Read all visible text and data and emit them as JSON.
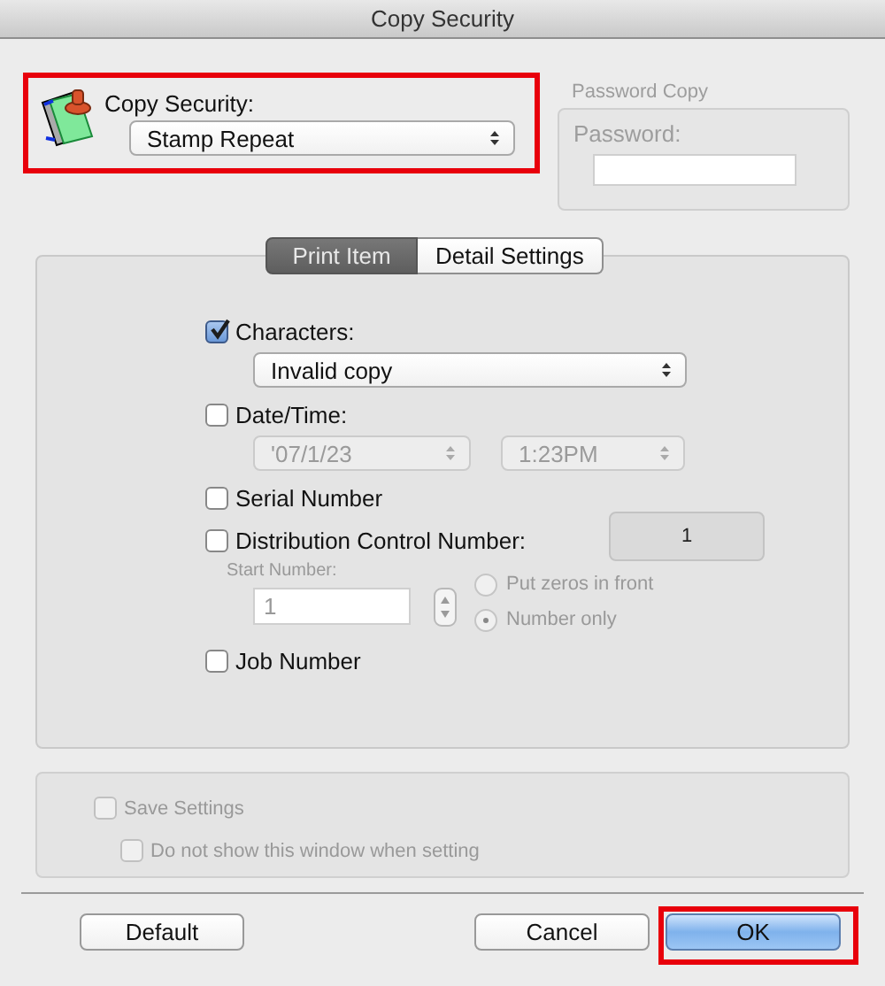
{
  "window": {
    "title": "Copy Security"
  },
  "copy_security": {
    "label": "Copy Security:",
    "value": "Stamp Repeat",
    "highlighted": true
  },
  "password_copy": {
    "title": "Password Copy",
    "label": "Password:",
    "disabled": true
  },
  "tabs": [
    {
      "label": "Print Item",
      "selected": true
    },
    {
      "label": "Detail Settings",
      "selected": false
    }
  ],
  "print_items": [
    {
      "kind": "popup",
      "label": "Characters:",
      "checked": true,
      "disabled": false,
      "value": "Invalid copy"
    },
    {
      "kind": "datetime",
      "label": "Date/Time:",
      "checked": false,
      "disabled": true,
      "date": "'07/1/23",
      "time": "1:23PM"
    },
    {
      "kind": "plain",
      "label": "Serial Number",
      "checked": false
    },
    {
      "kind": "distribution",
      "label": "Distribution Control Number:",
      "checked": false,
      "disabled": true,
      "display": "1",
      "start_label": "Start Number:",
      "start_value": "1",
      "options": [
        {
          "label": "Put zeros in front",
          "selected": false
        },
        {
          "label": "Number only",
          "selected": true
        }
      ]
    },
    {
      "kind": "plain",
      "label": "Job Number",
      "checked": false
    }
  ],
  "save": {
    "disabled": true,
    "options": [
      {
        "label": "Save Settings",
        "checked": false
      },
      {
        "label": "Do not show this window when setting",
        "checked": false
      }
    ]
  },
  "buttons": [
    {
      "label": "Default",
      "default": false,
      "highlighted": false
    },
    {
      "label": "Cancel",
      "default": false,
      "highlighted": false
    },
    {
      "label": "OK",
      "default": true,
      "highlighted": true
    }
  ]
}
